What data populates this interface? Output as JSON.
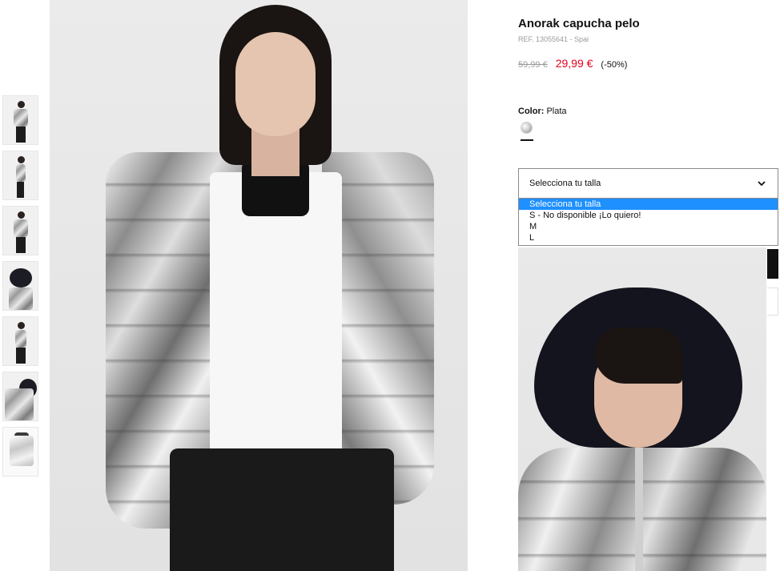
{
  "product": {
    "title": "Anorak capucha pelo",
    "reference": "REF. 13055641 - Spai",
    "old_price": "59,99 €",
    "new_price": "29,99 €",
    "discount": "(-50%)"
  },
  "color": {
    "label": "Color:",
    "value": "Plata",
    "swatch_icon": "silver-swatch-icon"
  },
  "size_select": {
    "selected": "Selecciona tu talla",
    "options": [
      "Selecciona tu talla",
      "S - No disponible ¡Lo quiero!",
      "M",
      "L"
    ]
  },
  "colors": {
    "price_red": "#e3001b",
    "highlight_blue": "#1e90ff"
  }
}
